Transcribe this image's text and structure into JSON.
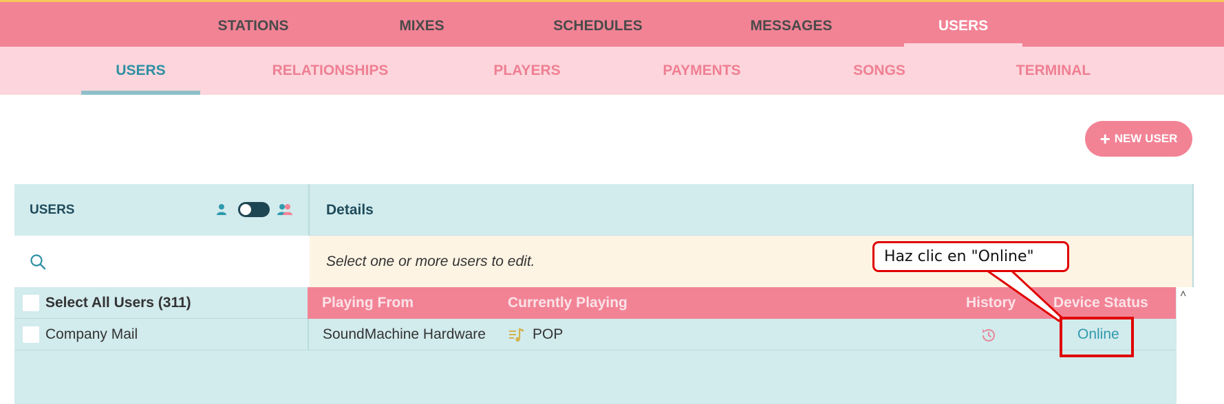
{
  "top_nav": [
    "STATIONS",
    "MIXES",
    "SCHEDULES",
    "MESSAGES",
    "USERS"
  ],
  "sub_nav": [
    "USERS",
    "RELATIONSHIPS",
    "PLAYERS",
    "PAYMENTS",
    "SONGS",
    "TERMINAL"
  ],
  "new_user_label": "NEW USER",
  "users_panel": {
    "title": "USERS",
    "select_all": "Select All Users (311)",
    "items": [
      "Company Mail"
    ]
  },
  "details": {
    "title": "Details",
    "hint": "Select one or more users to edit."
  },
  "table": {
    "headers": {
      "playing_from": "Playing From",
      "currently_playing": "Currently Playing",
      "history": "History",
      "device_status": "Device Status"
    },
    "rows": [
      {
        "playing_from": "SoundMachine Hardware",
        "currently_playing": "POP",
        "device_status": "Online"
      }
    ]
  },
  "annotation": {
    "text": "Haz clic en \"Online\""
  },
  "colors": {
    "brand_pink": "#f28395",
    "light_pink": "#fcd6dc",
    "teal": "#2f9aad",
    "panel": "#d2ebed",
    "annotation_red": "#e00000"
  }
}
